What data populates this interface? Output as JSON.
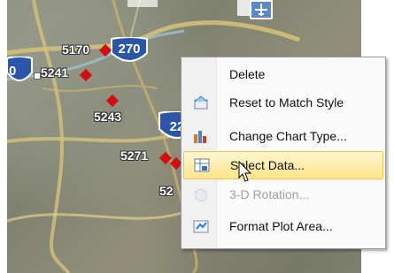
{
  "map": {
    "points": [
      {
        "label": "5170"
      },
      {
        "label": "5241"
      },
      {
        "label": "5243"
      },
      {
        "label": "5271"
      },
      {
        "label": "52"
      },
      {
        "label": "0"
      }
    ],
    "shields": [
      {
        "label": "270"
      },
      {
        "label": "22"
      }
    ]
  },
  "context_menu": {
    "items": [
      {
        "label": "Delete",
        "icon": "none",
        "enabled": true
      },
      {
        "label": "Reset to Match Style",
        "icon": "reset-style-icon",
        "enabled": true
      },
      {
        "label": "Change Chart Type...",
        "icon": "bar-chart-icon",
        "enabled": true
      },
      {
        "label": "Select Data...",
        "icon": "select-data-icon",
        "enabled": true,
        "highlighted": true
      },
      {
        "label": "3-D Rotation...",
        "icon": "3d-rotation-icon",
        "enabled": false
      },
      {
        "label": "Format Plot Area...",
        "icon": "format-plot-area-icon",
        "enabled": true
      }
    ]
  },
  "colors": {
    "marker": "#d10f12",
    "highlight": "#ffe58a",
    "shield_blue": "#2a55a8"
  }
}
